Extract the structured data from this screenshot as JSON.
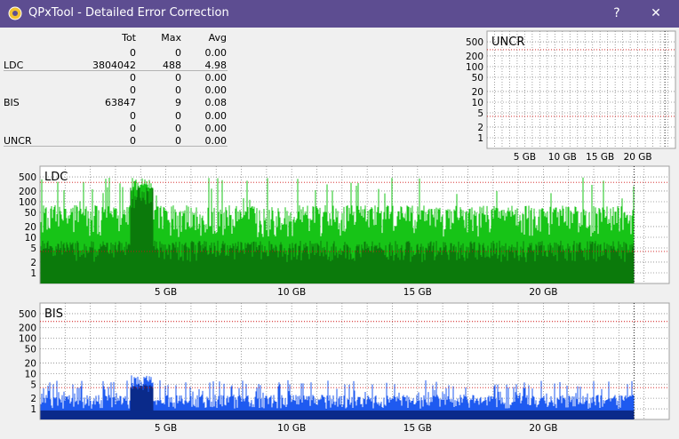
{
  "window": {
    "title": "QPxTool - Detailed Error Correction",
    "help_label": "?",
    "close_label": "✕",
    "titlebar_color": "#5d4d91"
  },
  "stats": {
    "headers": [
      "Tot",
      "Max",
      "Avg"
    ],
    "rows": [
      {
        "label": "",
        "tot": "0",
        "max": "0",
        "avg": "0.00"
      },
      {
        "label": "LDC",
        "tot": "3804042",
        "max": "488",
        "avg": "4.98"
      },
      {
        "label": "",
        "tot": "0",
        "max": "0",
        "avg": "0.00"
      },
      {
        "label": "",
        "tot": "0",
        "max": "0",
        "avg": "0.00"
      },
      {
        "label": "BIS",
        "tot": "63847",
        "max": "9",
        "avg": "0.08"
      },
      {
        "label": "",
        "tot": "0",
        "max": "0",
        "avg": "0.00"
      },
      {
        "label": "",
        "tot": "0",
        "max": "0",
        "avg": "0.00"
      },
      {
        "label": "UNCR",
        "tot": "0",
        "max": "0",
        "avg": "0.00"
      }
    ]
  },
  "chart_data": [
    {
      "id": "uncr",
      "type": "bar",
      "title": "UNCR",
      "y_scale": "log",
      "y_ticks": [
        1,
        2,
        5,
        10,
        20,
        50,
        100,
        200,
        500
      ],
      "x_ticks": [
        "5 GB",
        "10 GB",
        "15 GB",
        "20 GB"
      ],
      "x_tick_values": [
        5,
        10,
        15,
        20
      ],
      "x_range": [
        0,
        25
      ],
      "end_marker_gb": 23.6,
      "series": [],
      "colors": {
        "background": "#ffffff",
        "grid": "#8a8a8a",
        "limit": "#d01010"
      }
    },
    {
      "id": "ldc",
      "type": "bar",
      "title": "LDC",
      "y_scale": "log",
      "y_ticks": [
        1,
        2,
        5,
        10,
        20,
        50,
        100,
        200,
        500
      ],
      "x_ticks": [
        "5 GB",
        "10 GB",
        "15 GB",
        "20 GB"
      ],
      "x_tick_values": [
        5,
        10,
        15,
        20
      ],
      "x_range": [
        0,
        25
      ],
      "end_marker_gb": 23.6,
      "max": 488,
      "avg": 4.98,
      "colors": {
        "peak": "#17c417",
        "bulk": "#0b7a0b",
        "background": "#ffffff",
        "grid": "#8a8a8a",
        "limit": "#d01010"
      }
    },
    {
      "id": "bis",
      "type": "bar",
      "title": "BIS",
      "y_scale": "log",
      "y_ticks": [
        1,
        2,
        5,
        10,
        20,
        50,
        100,
        200,
        500
      ],
      "x_ticks": [
        "5 GB",
        "10 GB",
        "15 GB",
        "20 GB"
      ],
      "x_tick_values": [
        5,
        10,
        15,
        20
      ],
      "x_range": [
        0,
        25
      ],
      "end_marker_gb": 23.6,
      "max": 9,
      "avg": 0.08,
      "colors": {
        "peak": "#1e5af0",
        "bulk": "#0a2a8a",
        "background": "#ffffff",
        "grid": "#8a8a8a",
        "limit": "#d01010"
      }
    }
  ]
}
